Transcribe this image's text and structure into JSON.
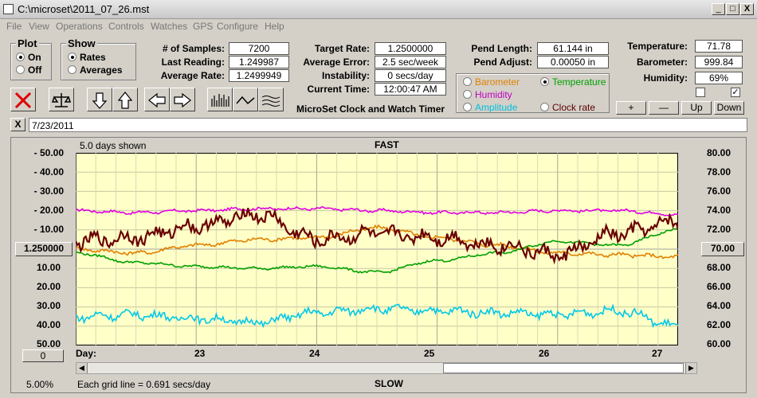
{
  "window": {
    "title": "C:\\microset\\2011_07_26.mst",
    "min": "_",
    "max": "□",
    "close": "X"
  },
  "menu": [
    "File",
    "View",
    "Operations",
    "Controls",
    "Watches",
    "GPS",
    "Configure",
    "Help"
  ],
  "plot_group": {
    "title": "Plot",
    "on": "On",
    "off": "Off"
  },
  "show_group": {
    "title": "Show",
    "rates": "Rates",
    "averages": "Averages"
  },
  "stats": {
    "samples_label": "# of Samples:",
    "samples": "7200",
    "last_label": "Last Reading:",
    "last": "1.249987",
    "avg_label": "Average Rate:",
    "avg": "1.2499949",
    "target_label": "Target Rate:",
    "target": "1.2500000",
    "err_label": "Average Error:",
    "err": "2.5 sec/week",
    "inst_label": "Instability:",
    "inst": "0 secs/day",
    "time_label": "Current Time:",
    "time": "12:00:47 AM",
    "pendlen_label": "Pend Length:",
    "pendlen": "61.144 in",
    "pendadj_label": "Pend Adjust:",
    "pendadj": "0.00050 in",
    "temp_label": "Temperature:",
    "temp": "71.78",
    "baro_label": "Barometer:",
    "baro": "999.84",
    "hum_label": "Humidity:",
    "hum": "69%"
  },
  "app_name": "MicroSet Clock and Watch Timer",
  "sensor_options": {
    "barometer": "Barometer",
    "temperature": "Temperature",
    "humidity": "Humidity",
    "amplitude": "Amplitude",
    "clockrate": "Clock rate"
  },
  "buttons": {
    "plus": "+",
    "minus": "—",
    "up": "Up",
    "down": "Down",
    "clear": "X"
  },
  "date_field": "7/23/2011",
  "colors": {
    "barometer": "#e08000",
    "temperature": "#00a000",
    "humidity": "#e000e0",
    "amplitude": "#00c8e8",
    "clockrate": "#6a0000",
    "plotbg": "#ffffc8"
  },
  "chart_data": {
    "type": "line",
    "title": "FAST",
    "bottom_title": "SLOW",
    "days_shown": "5.0 days shown",
    "grid_note": "Each grid line = 0.691 secs/day",
    "zoom": "5.00%",
    "center_value": "1.250000",
    "right_center": "70.00",
    "bottom_left_btn": "0",
    "xlabel": "Day:",
    "x_ticks": [
      "23",
      "24",
      "25",
      "26",
      "27"
    ],
    "left_ticks": [
      "50.00",
      "40.00",
      "30.00",
      "20.00",
      "10.00",
      "10.00",
      "20.00",
      "30.00",
      "40.00",
      "50.00"
    ],
    "right_ticks": [
      "80.00",
      "78.00",
      "76.00",
      "74.00",
      "72.00",
      "68.00",
      "66.00",
      "64.00",
      "62.00",
      "60.00"
    ],
    "xlim": [
      22.0,
      27.0
    ],
    "ylim_left": [
      -50,
      50
    ],
    "ylim_right": [
      60,
      80
    ],
    "series": [
      {
        "name": "Humidity",
        "color": "#e000e0",
        "x": [
          22.0,
          22.5,
          23.0,
          23.5,
          24.0,
          24.5,
          25.0,
          25.5,
          26.0,
          26.5,
          27.0
        ],
        "y": [
          20,
          19,
          20,
          21,
          21,
          20,
          19,
          19,
          20,
          20,
          18
        ]
      },
      {
        "name": "Barometer",
        "color": "#e08000",
        "x": [
          22.0,
          22.5,
          23.0,
          23.5,
          24.0,
          24.5,
          25.0,
          25.5,
          26.0,
          26.5,
          27.0
        ],
        "y": [
          0,
          -2,
          2,
          5,
          6,
          11,
          6,
          2,
          -2,
          -3,
          -4
        ]
      },
      {
        "name": "Temperature",
        "color": "#00a000",
        "x": [
          22.0,
          22.5,
          23.0,
          23.5,
          24.0,
          24.5,
          25.0,
          25.5,
          26.0,
          26.5,
          27.0
        ],
        "y": [
          -2,
          -7,
          -9,
          -10,
          -9,
          -12,
          -6,
          -2,
          4,
          2,
          10
        ]
      },
      {
        "name": "Amplitude",
        "color": "#00c8e8",
        "x": [
          22.0,
          22.5,
          23.0,
          23.5,
          24.0,
          24.5,
          25.0,
          25.5,
          26.0,
          26.5,
          27.0
        ],
        "y": [
          -35,
          -34,
          -36,
          -38,
          -33,
          -31,
          -32,
          -33,
          -34,
          -32,
          -40
        ]
      },
      {
        "name": "Clock rate",
        "color": "#6a0000",
        "x": [
          22.0,
          22.5,
          23.0,
          23.5,
          24.0,
          24.5,
          25.0,
          25.5,
          26.0,
          26.5,
          27.0
        ],
        "y": [
          4,
          6,
          12,
          18,
          5,
          8,
          6,
          2,
          -3,
          8,
          14
        ]
      }
    ]
  }
}
